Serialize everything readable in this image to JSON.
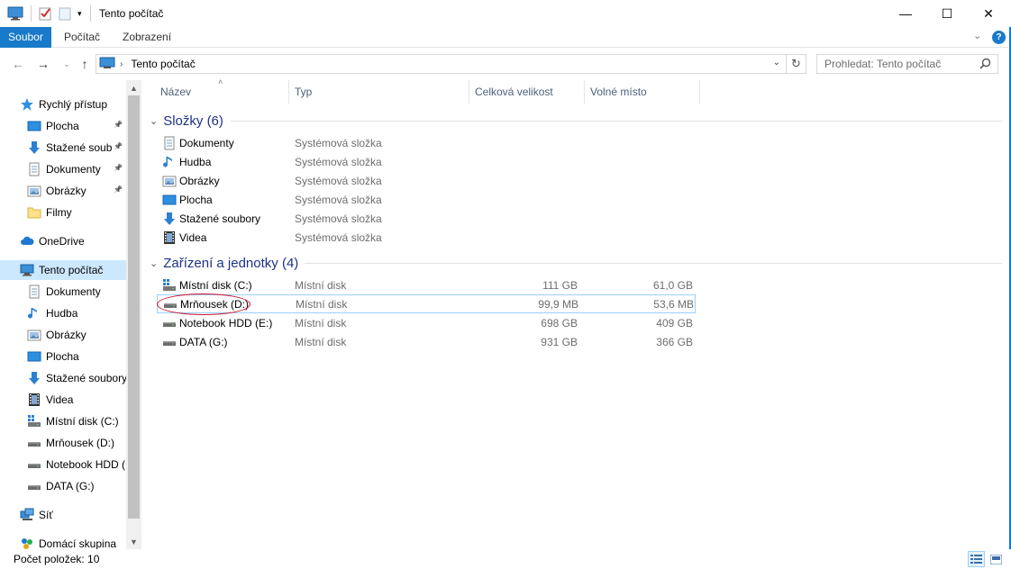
{
  "window": {
    "title": "Tento počítač",
    "controls": {
      "minimize": "—",
      "maximize": "☐",
      "close": "✕"
    }
  },
  "ribbon": {
    "tabs": [
      "Soubor",
      "Počítač",
      "Zobrazení"
    ],
    "help": "?"
  },
  "address": {
    "path": "Tento počítač",
    "search_placeholder": "Prohledat: Tento počítač"
  },
  "sidebar": {
    "items": [
      {
        "label": "Rychlý přístup",
        "icon": "star-icon"
      },
      {
        "label": "Plocha",
        "icon": "desktop-icon",
        "pinned": true
      },
      {
        "label": "Stažené soub",
        "icon": "download-icon",
        "pinned": true
      },
      {
        "label": "Dokumenty",
        "icon": "documents-icon",
        "pinned": true
      },
      {
        "label": "Obrázky",
        "icon": "pictures-icon",
        "pinned": true
      },
      {
        "label": "Filmy",
        "icon": "folder-icon"
      },
      {
        "label": "OneDrive",
        "icon": "cloud-icon"
      },
      {
        "label": "Tento počítač",
        "icon": "computer-icon",
        "selected": true
      },
      {
        "label": "Dokumenty",
        "icon": "documents-icon"
      },
      {
        "label": "Hudba",
        "icon": "music-icon"
      },
      {
        "label": "Obrázky",
        "icon": "pictures-icon"
      },
      {
        "label": "Plocha",
        "icon": "desktop-icon"
      },
      {
        "label": "Stažené soubory",
        "icon": "download-icon"
      },
      {
        "label": "Videa",
        "icon": "videos-icon"
      },
      {
        "label": "Místní disk (C:)",
        "icon": "system-drive-icon"
      },
      {
        "label": "Mrňousek (D:)",
        "icon": "drive-icon"
      },
      {
        "label": "Notebook HDD (",
        "icon": "drive-icon"
      },
      {
        "label": "DATA (G:)",
        "icon": "drive-icon"
      },
      {
        "label": "Síť",
        "icon": "network-icon"
      },
      {
        "label": "Domácí skupina",
        "icon": "homegroup-icon"
      }
    ]
  },
  "columns": {
    "name": "Název",
    "type": "Typ",
    "total": "Celková velikost",
    "free": "Volné místo"
  },
  "groups": [
    {
      "title": "Složky (6)",
      "items": [
        {
          "name": "Dokumenty",
          "type": "Systémová složka",
          "icon": "documents-icon"
        },
        {
          "name": "Hudba",
          "type": "Systémová složka",
          "icon": "music-icon"
        },
        {
          "name": "Obrázky",
          "type": "Systémová složka",
          "icon": "pictures-icon"
        },
        {
          "name": "Plocha",
          "type": "Systémová složka",
          "icon": "desktop-icon"
        },
        {
          "name": "Stažené soubory",
          "type": "Systémová složka",
          "icon": "download-icon"
        },
        {
          "name": "Videa",
          "type": "Systémová složka",
          "icon": "videos-icon"
        }
      ]
    },
    {
      "title": "Zařízení a jednotky (4)",
      "items": [
        {
          "name": "Místní disk (C:)",
          "type": "Místní disk",
          "total": "111 GB",
          "free": "61,0 GB",
          "icon": "system-drive-icon"
        },
        {
          "name": "Mrňousek (D:)",
          "type": "Místní disk",
          "total": "99,9 MB",
          "free": "53,6 MB",
          "icon": "drive-icon"
        },
        {
          "name": "Notebook HDD (E:)",
          "type": "Místní disk",
          "total": "698 GB",
          "free": "409 GB",
          "icon": "drive-icon"
        },
        {
          "name": "DATA (G:)",
          "type": "Místní disk",
          "total": "931 GB",
          "free": "366 GB",
          "icon": "drive-icon"
        }
      ]
    }
  ],
  "status": {
    "count": "Počet položek: 10"
  },
  "colors": {
    "accent": "#1979ca",
    "selected": "#cce8ff",
    "group_title": "#1e3287",
    "annotation": "#c8102e"
  }
}
